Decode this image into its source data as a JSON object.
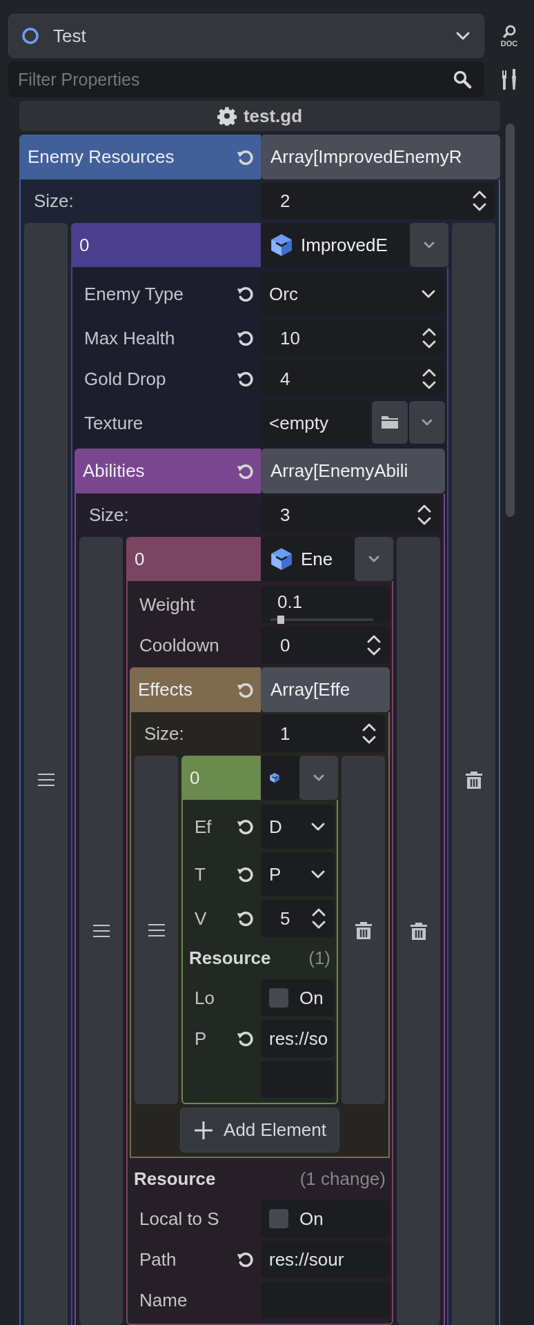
{
  "inspector_object": {
    "name": "Test"
  },
  "doc_button": {
    "label": "DOC"
  },
  "filter": {
    "placeholder": "Filter Properties"
  },
  "script": {
    "name": "test.gd"
  },
  "properties": [
    {
      "kind": "array",
      "label": "Enemy Resources",
      "revertable": true,
      "value": "Array[ImprovedEnemyR",
      "size_label": "Size:",
      "size": "2",
      "elements": [
        {
          "index": "0",
          "class_name": "ImprovedE",
          "properties": [
            {
              "kind": "enum",
              "label": "Enemy Type",
              "revertable": true,
              "value": "Orc"
            },
            {
              "kind": "number",
              "label": "Max Health",
              "revertable": true,
              "value": "10"
            },
            {
              "kind": "number",
              "label": "Gold Drop",
              "revertable": true,
              "value": "4"
            },
            {
              "kind": "resource",
              "label": "Texture",
              "value": "<empty"
            },
            {
              "kind": "array",
              "label": "Abilities",
              "revertable": true,
              "value": "Array[EnemyAbili",
              "size_label": "Size:",
              "size": "3",
              "elements": [
                {
                  "index": "0",
                  "class_name": "Ene",
                  "properties": [
                    {
                      "kind": "slider",
                      "label": "Weight",
                      "value": "0.1",
                      "level": 0.1
                    },
                    {
                      "kind": "number",
                      "label": "Cooldown",
                      "value": "0"
                    },
                    {
                      "kind": "array",
                      "label": "Effects",
                      "revertable": true,
                      "value": "Array[Effe",
                      "size_label": "Size:",
                      "size": "1",
                      "add_button": "Add Element",
                      "elements": [
                        {
                          "index": "0",
                          "properties": [
                            {
                              "kind": "enum",
                              "label": "Ef",
                              "revertable": true,
                              "value": "D"
                            },
                            {
                              "kind": "enum",
                              "label": "T",
                              "revertable": true,
                              "value": "P"
                            },
                            {
                              "kind": "number",
                              "label": "V",
                              "revertable": true,
                              "value": "5"
                            },
                            {
                              "kind": "section",
                              "title": "Resource",
                              "note": "(1)",
                              "properties": [
                                {
                                  "kind": "checkbox",
                                  "label": "Lo",
                                  "checked": false,
                                  "value": "On"
                                },
                                {
                                  "kind": "text",
                                  "label": "P",
                                  "revertable": true,
                                  "value": "res://so"
                                },
                                {
                                  "kind": "text"
                                }
                              ]
                            }
                          ]
                        }
                      ]
                    },
                    {
                      "kind": "section",
                      "title": "Resource",
                      "note": "(1 change)",
                      "properties": [
                        {
                          "kind": "checkbox",
                          "label": "Local to S",
                          "checked": false,
                          "value": "On"
                        },
                        {
                          "kind": "text",
                          "label": "Path",
                          "revertable": true,
                          "value": "res://sour"
                        },
                        {
                          "kind": "text",
                          "label": "Name"
                        }
                      ]
                    }
                  ]
                }
              ]
            }
          ]
        }
      ]
    }
  ]
}
